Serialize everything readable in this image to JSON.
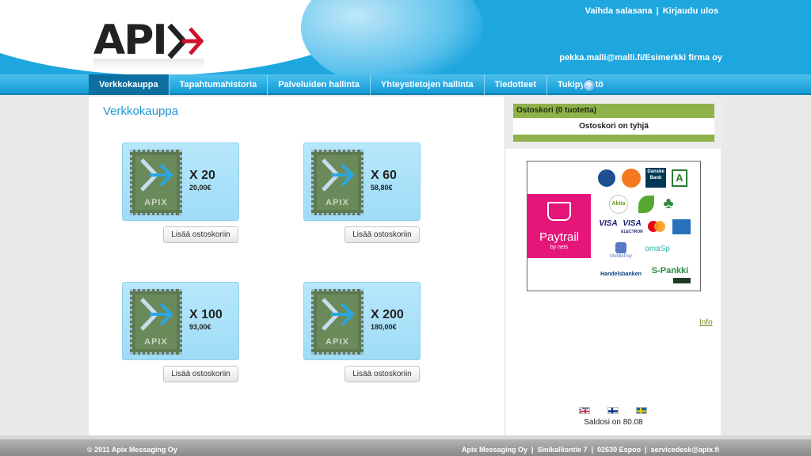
{
  "header": {
    "logo_text": "APIX",
    "links": {
      "change_password": "Vaihda salasana",
      "separator": "|",
      "logout": "Kirjaudu ulos"
    },
    "user": "pekka.malli@malli.fi/Esimerkki firma oy"
  },
  "nav": {
    "items": [
      {
        "label": "Verkkokauppa"
      },
      {
        "label": "Tapahtumahistoria"
      },
      {
        "label": "Palveluiden hallinta"
      },
      {
        "label": "Yhteystietojen hallinta"
      },
      {
        "label": "Tiedotteet"
      },
      {
        "label": "Tukipyyntö"
      }
    ],
    "help": "?"
  },
  "main": {
    "title": "Verkkokauppa",
    "stamp_text": "APIX",
    "products": [
      {
        "qty": "X 20",
        "price": "20,00€",
        "button": "Lisää ostoskoriin"
      },
      {
        "qty": "X 60",
        "price": "58,80€",
        "button": "Lisää ostoskoriin"
      },
      {
        "qty": "X 100",
        "price": "93,00€",
        "button": "Lisää ostoskoriin"
      },
      {
        "qty": "X 200",
        "price": "180,00€",
        "button": "Lisää ostoskoriin"
      }
    ]
  },
  "cart": {
    "header": "Ostoskori (0 tuotetta)",
    "empty": "Ostoskori on tyhjä"
  },
  "payments": {
    "brand": "Paytrail",
    "brand_sub": "by nets",
    "banks": {
      "danske": "Danske Bank",
      "aktia": "Aktia",
      "visa": "VISA",
      "visa_electron": "VISA",
      "visa_electron_sub": "ELECTRON",
      "mobilepay": "MobilePay",
      "omasp": "omaSp",
      "handelsbanken": "Handelsbanken",
      "spankki": "S-Pankki"
    }
  },
  "sidebar": {
    "info": "Info",
    "balance": "Saldosi on 80.08"
  },
  "footer": {
    "copyright": "© 2011 Apix Messaging Oy",
    "company": "Apix Messaging Oy",
    "street": "Sinikalliontie 7",
    "city": "02630 Espoo",
    "email": "servicedesk@apix.fi",
    "separator": "|"
  }
}
